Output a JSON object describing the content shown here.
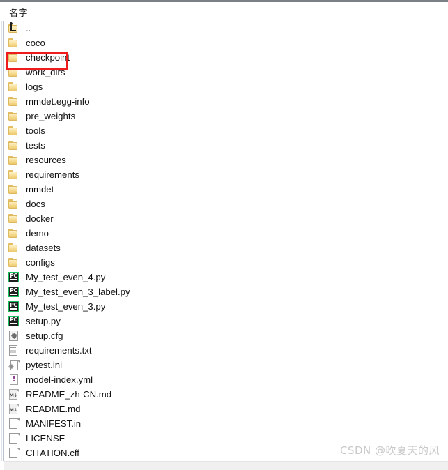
{
  "window": {
    "title": "File Explorer",
    "column_header": "名字"
  },
  "watermark": {
    "text": "CSDN @吹夏天的风"
  },
  "highlight": {
    "color": "#ee1c1c",
    "target_item": "coco"
  },
  "colors": {
    "folder": "#f5dd9a",
    "pycharm_accent": "#16c060",
    "text": "#111111",
    "highlight_red": "#ee1c1c",
    "watermark_gray": "#c9c9c9"
  },
  "file_list": {
    "items": [
      {
        "name": "..",
        "icon": "up-folder-icon",
        "type": "parent"
      },
      {
        "name": "coco",
        "icon": "folder-icon",
        "type": "folder"
      },
      {
        "name": "checkpoint",
        "icon": "folder-icon",
        "type": "folder"
      },
      {
        "name": "work_dirs",
        "icon": "folder-icon",
        "type": "folder"
      },
      {
        "name": "logs",
        "icon": "folder-icon",
        "type": "folder"
      },
      {
        "name": "mmdet.egg-info",
        "icon": "folder-icon",
        "type": "folder"
      },
      {
        "name": "pre_weights",
        "icon": "folder-icon",
        "type": "folder"
      },
      {
        "name": "tools",
        "icon": "folder-icon",
        "type": "folder"
      },
      {
        "name": "tests",
        "icon": "folder-icon",
        "type": "folder"
      },
      {
        "name": "resources",
        "icon": "folder-icon",
        "type": "folder"
      },
      {
        "name": "requirements",
        "icon": "folder-icon",
        "type": "folder"
      },
      {
        "name": "mmdet",
        "icon": "folder-icon",
        "type": "folder"
      },
      {
        "name": "docs",
        "icon": "folder-icon",
        "type": "folder"
      },
      {
        "name": "docker",
        "icon": "folder-icon",
        "type": "folder"
      },
      {
        "name": "demo",
        "icon": "folder-icon",
        "type": "folder"
      },
      {
        "name": "datasets",
        "icon": "folder-icon",
        "type": "folder"
      },
      {
        "name": "configs",
        "icon": "folder-icon",
        "type": "folder"
      },
      {
        "name": "My_test_even_4.py",
        "icon": "pycharm-python-icon",
        "type": "file"
      },
      {
        "name": "My_test_even_3_label.py",
        "icon": "pycharm-python-icon",
        "type": "file"
      },
      {
        "name": "My_test_even_3.py",
        "icon": "pycharm-python-icon",
        "type": "file"
      },
      {
        "name": "setup.py",
        "icon": "pycharm-python-icon",
        "type": "file"
      },
      {
        "name": "setup.cfg",
        "icon": "gear-config-icon",
        "type": "file"
      },
      {
        "name": "requirements.txt",
        "icon": "text-document-icon",
        "type": "file"
      },
      {
        "name": "pytest.ini",
        "icon": "ini-config-icon",
        "type": "file"
      },
      {
        "name": "model-index.yml",
        "icon": "yaml-icon",
        "type": "file"
      },
      {
        "name": "README_zh-CN.md",
        "icon": "markdown-icon",
        "type": "file"
      },
      {
        "name": "README.md",
        "icon": "markdown-icon",
        "type": "file"
      },
      {
        "name": "MANIFEST.in",
        "icon": "blank-document-icon",
        "type": "file"
      },
      {
        "name": "LICENSE",
        "icon": "blank-document-icon",
        "type": "file"
      },
      {
        "name": "CITATION.cff",
        "icon": "blank-document-icon",
        "type": "file"
      }
    ]
  }
}
